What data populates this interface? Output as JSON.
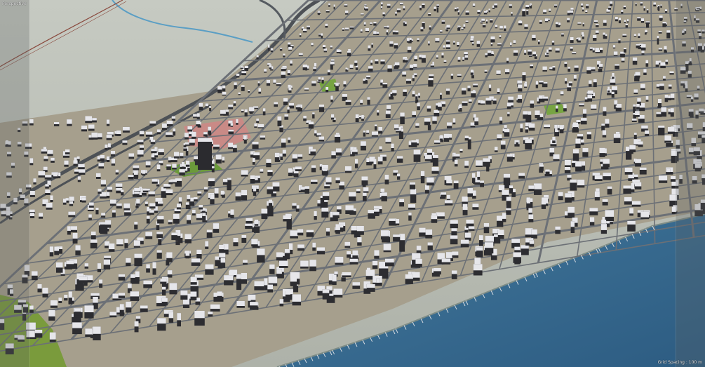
{
  "viewport": {
    "view_label": "Perspective",
    "grid_label": "Grid Spacing : 100 m",
    "camera": "perspective"
  },
  "colors": {
    "terrain": "#b3b7ae",
    "terrain_far": "#c4c8bf",
    "block_ground": "#a79f8c",
    "street": "#6c7076",
    "building_top": "#e6e6ea",
    "building_side": "#2d2d31",
    "water": "#3b6e94",
    "water_deep": "#2f5f85",
    "park": "#6b9a3a",
    "plaza": "#c98a86",
    "river": "#5a9ec4",
    "rail": "#8a4a3e",
    "frame_tint": "#5e6062"
  },
  "icons": []
}
